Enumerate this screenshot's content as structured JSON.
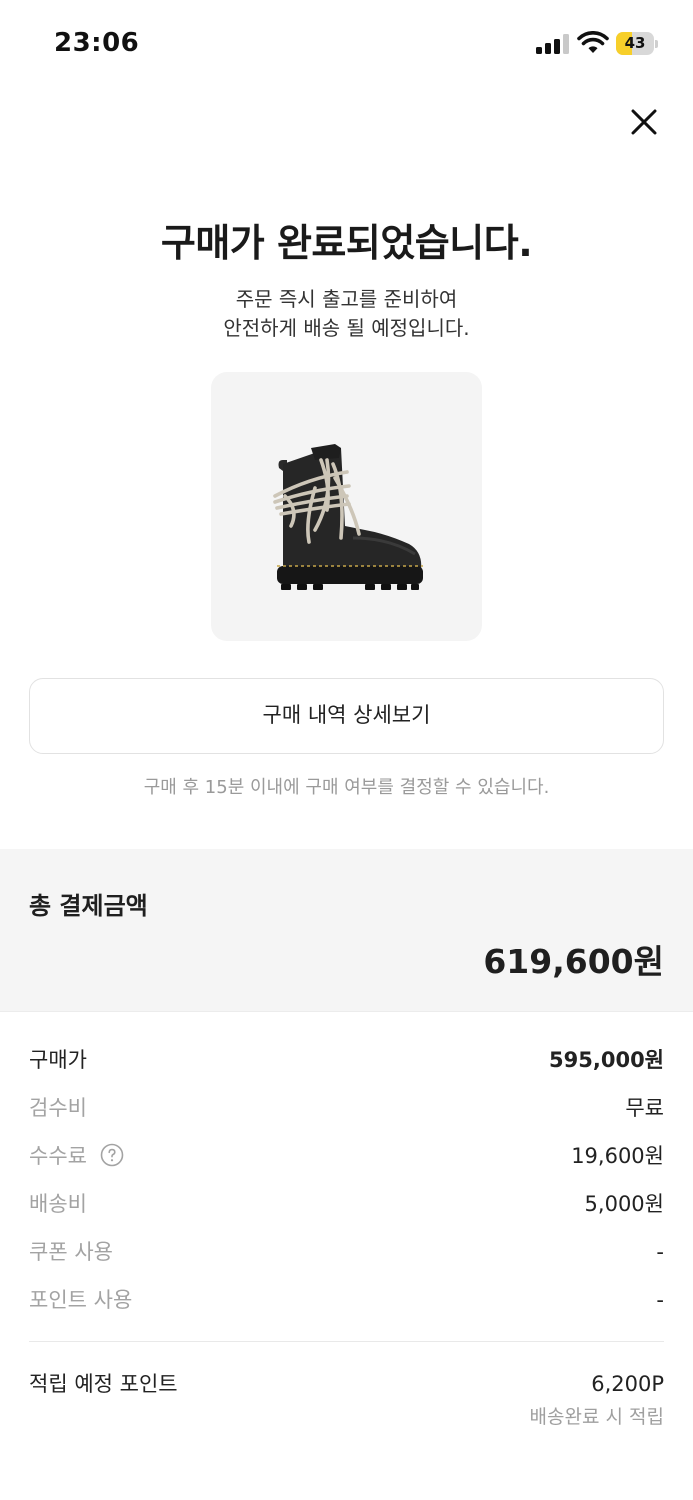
{
  "status_bar": {
    "time": "23:06",
    "battery_level": "43",
    "battery_fraction": 0.43,
    "battery_color": "#f7cf2a",
    "icons": [
      "signal-icon",
      "wifi-icon",
      "battery-icon"
    ]
  },
  "header": {
    "close_icon": "close-icon"
  },
  "confirmation": {
    "title": "구매가 완료되었습니다.",
    "subtitle_line1": "주문 즉시 출고를 준비하여",
    "subtitle_line2": "안전하게 배송 될 예정입니다."
  },
  "product": {
    "image": "boot-image"
  },
  "actions": {
    "detail_button_label": "구매 내역 상세보기",
    "notice": "구매 후 15분 이내에 구매 여부를 결정할 수 있습니다."
  },
  "total": {
    "label": "총 결제금액",
    "value": "619,600원"
  },
  "breakdown": [
    {
      "label": "구매가",
      "value": "595,000원"
    },
    {
      "label": "검수비",
      "value": "무료"
    },
    {
      "label": "수수료",
      "value": "19,600원",
      "help_icon": "question-circle-icon"
    },
    {
      "label": "배송비",
      "value": "5,000원"
    },
    {
      "label": "쿠폰 사용",
      "value": "-"
    },
    {
      "label": "포인트 사용",
      "value": "-"
    }
  ],
  "points": {
    "label": "적립 예정 포인트",
    "value": "6,200P",
    "sub": "배송완료 시 적립"
  }
}
